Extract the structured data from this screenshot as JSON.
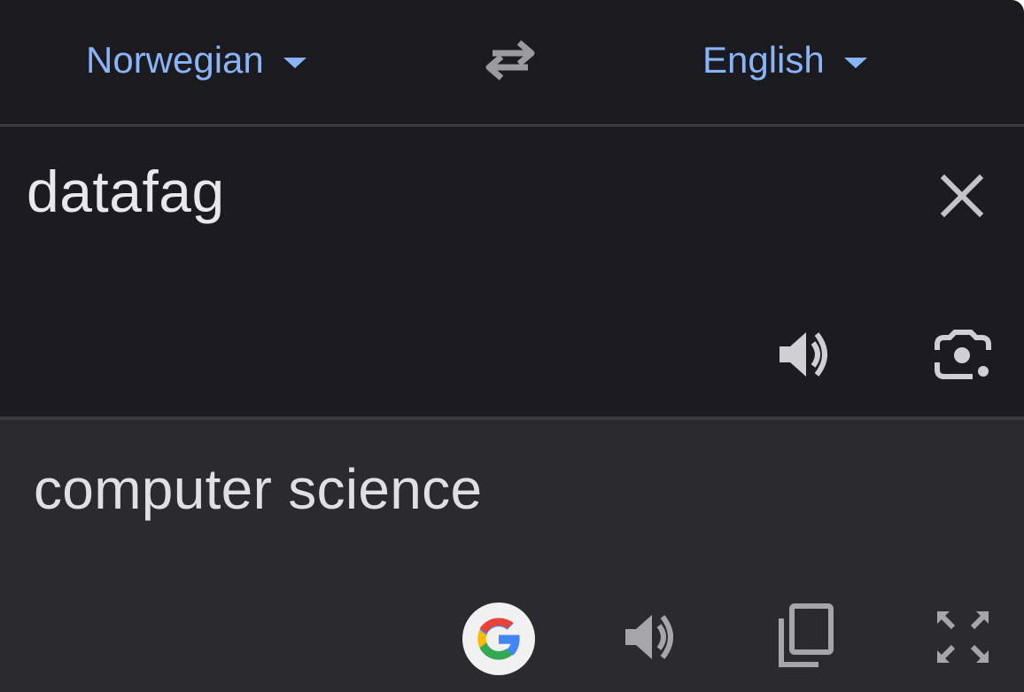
{
  "languages": {
    "source": "Norwegian",
    "target": "English"
  },
  "input": {
    "text": "datafag"
  },
  "output": {
    "text": "computer science"
  },
  "icons": {
    "swap": "swap-arrows-icon",
    "clear": "close-icon",
    "listen_source": "speaker-icon",
    "camera": "lens-camera-icon",
    "google": "google-g-icon",
    "listen_target": "speaker-icon",
    "copy": "copy-icon",
    "fullscreen": "fullscreen-icon"
  },
  "colors": {
    "accent": "#8ab4f8",
    "background": "#1b1b21",
    "output_background": "#2a2a2f",
    "icon": "#bdbdc2"
  }
}
